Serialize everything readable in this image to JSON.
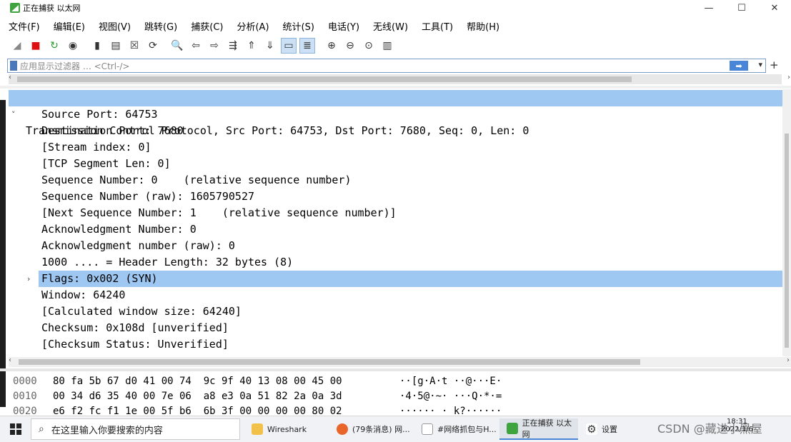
{
  "window": {
    "title": "正在捕获 以太网",
    "minimize": "—",
    "maximize": "☐",
    "close": "✕"
  },
  "menu": [
    "文件(F)",
    "编辑(E)",
    "视图(V)",
    "跳转(G)",
    "捕获(C)",
    "分析(A)",
    "统计(S)",
    "电话(Y)",
    "无线(W)",
    "工具(T)",
    "帮助(H)"
  ],
  "toolbar_icons": [
    "shark-fin-icon",
    "stop-icon",
    "restart-icon",
    "options-gear-icon",
    "open-file-icon",
    "save-file-icon",
    "close-file-icon",
    "reload-icon",
    "find-icon",
    "back-icon",
    "forward-icon",
    "goto-packet-icon",
    "first-packet-icon",
    "last-packet-icon",
    "autoscroll-icon",
    "colorize-icon",
    "zoom-in-icon",
    "zoom-out-icon",
    "zoom-normal-icon",
    "resize-columns-icon"
  ],
  "toolbar_glyphs": [
    "◢",
    "■",
    "↻",
    "◉",
    "▮",
    "▤",
    "☒",
    "⟳",
    "🔍",
    "⇦",
    "⇨",
    "⇶",
    "⇑",
    "⇓",
    "▭",
    "≣",
    "⊕",
    "⊖",
    "⊙",
    "▥"
  ],
  "filter": {
    "placeholder": "应用显示过滤器 … <Ctrl-/>",
    "apply_arrow": "➡",
    "dropdown": "▾",
    "plus": "+"
  },
  "detail": {
    "header": "Transmission Control Protocol, Src Port: 64753, Dst Port: 7680, Seq: 0, Len: 0",
    "header_expander": "˅",
    "lines": [
      "Source Port: 64753",
      "Destination Port: 7680",
      "[Stream index: 0]",
      "[TCP Segment Len: 0]",
      "Sequence Number: 0    (relative sequence number)",
      "Sequence Number (raw): 1605790527",
      "[Next Sequence Number: 1    (relative sequence number)]",
      "Acknowledgment Number: 0",
      "Acknowledgment number (raw): 0",
      "1000 .... = Header Length: 32 bytes (8)",
      "Flags: 0x002 (SYN)",
      "Window: 64240",
      "[Calculated window size: 64240]",
      "Checksum: 0x108d [unverified]",
      "[Checksum Status: Unverified]"
    ],
    "flags_expander": "›"
  },
  "bytes": [
    {
      "offset": "0000",
      "hex": "80 fa 5b 67 d0 41 00 74  9c 9f 40 13 08 00 45 00",
      "ascii": "··[g·A·t ··@···E·"
    },
    {
      "offset": "0010",
      "hex": "00 34 d6 35 40 00 7e 06  a8 e3 0a 51 82 2a 0a 3d",
      "ascii": "·4·5@·~· ···Q·*·="
    },
    {
      "offset": "0020",
      "hex": "e6 f2 fc f1 1e 00 5f b6  6b 3f 00 00 00 00 80 02",
      "ascii": "······_· k?······"
    }
  ],
  "taskbar": {
    "search_text": "在这里输入你要搜索的内容",
    "tasks": [
      {
        "label": "Wireshark",
        "color": "#f2c14a"
      },
      {
        "label": "(79条消息) 网...",
        "color": "#e8662a"
      },
      {
        "label": "#网络抓包与H...",
        "color": "#ffffff"
      },
      {
        "label": "正在捕获 以太网",
        "color": "#3fa33f"
      },
      {
        "label": "设置",
        "color": "#ffffff"
      }
    ],
    "watermark": "CSDN @藏进小黑屋",
    "clock_time": "18:31",
    "clock_date": "2022/1/6"
  },
  "colors": {
    "selection": "#9ec7f2",
    "accent": "#4a86d8"
  }
}
